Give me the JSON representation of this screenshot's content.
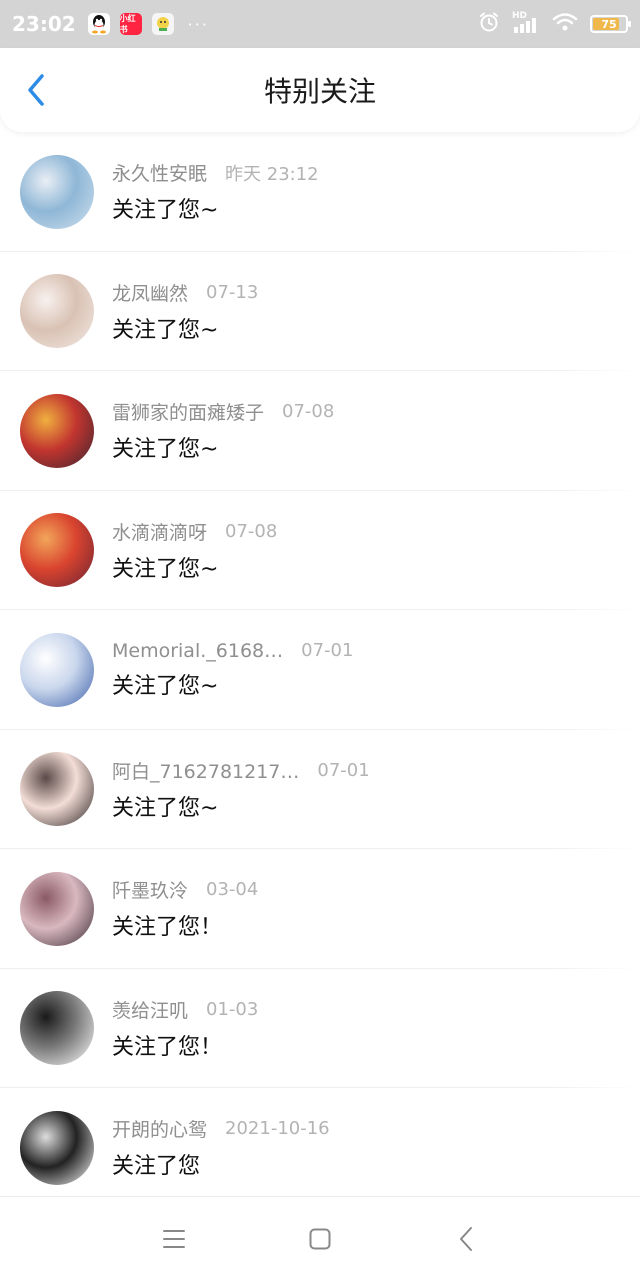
{
  "status_bar": {
    "time": "23:02",
    "apps": [
      {
        "name": "qq-icon",
        "label": ""
      },
      {
        "name": "xiaohongshu-icon",
        "label": "小红书"
      },
      {
        "name": "app-icon",
        "label": ""
      }
    ],
    "more": "···",
    "battery_level": "75",
    "signal_label": "HD"
  },
  "header": {
    "title": "特别关注",
    "back_icon": "chevron-left-icon"
  },
  "notifications": [
    {
      "name": "永久性安眠",
      "date": "昨天 23:12",
      "message": "关注了您~",
      "avatar_colors": [
        "#cfe0ef",
        "#8fb7d6",
        "#e9eef5"
      ]
    },
    {
      "name": "龙凤幽然",
      "date": "07-13",
      "message": "关注了您~",
      "avatar_colors": [
        "#f3e9e4",
        "#d9c2b4",
        "#f8f1ee"
      ]
    },
    {
      "name": "雷狮家的面瘫矮子",
      "date": "07-08",
      "message": "关注了您~",
      "avatar_colors": [
        "#3b2530",
        "#c2352f",
        "#f0b040"
      ]
    },
    {
      "name": "水滴滴滴呀",
      "date": "07-08",
      "message": "关注了您~",
      "avatar_colors": [
        "#6a2233",
        "#d9442f",
        "#f2a65a"
      ]
    },
    {
      "name": "Memorial._6168…",
      "date": "07-01",
      "message": "关注了您~",
      "avatar_colors": [
        "#3a5fa8",
        "#c9d6ec",
        "#ffffff"
      ]
    },
    {
      "name": "阿白_7162781217…",
      "date": "07-01",
      "message": "关注了您~",
      "avatar_colors": [
        "#2a2222",
        "#f3ddd6",
        "#5a4a48"
      ]
    },
    {
      "name": "阡墨玖泠",
      "date": "03-04",
      "message": "关注了您！",
      "avatar_colors": [
        "#3a2a33",
        "#d9b8c0",
        "#8a5a66"
      ]
    },
    {
      "name": "羡给汪叽",
      "date": "01-03",
      "message": "关注了您！",
      "avatar_colors": [
        "#ffffff",
        "#7a7a7a",
        "#1a1a1a"
      ]
    },
    {
      "name": "开朗的心鸳",
      "date": "2021-10-16",
      "message": "关注了您",
      "avatar_colors": [
        "#ffffff",
        "#222222",
        "#dddddd"
      ]
    }
  ],
  "nav_bar": {
    "icons": [
      "menu-icon",
      "home-square-icon",
      "back-triangle-icon"
    ]
  },
  "colors": {
    "accent": "#2d8ce6",
    "name_text": "#8f8f8f",
    "date_text": "#b3b3b3",
    "status_bar_bg": "#d4d4d4"
  }
}
